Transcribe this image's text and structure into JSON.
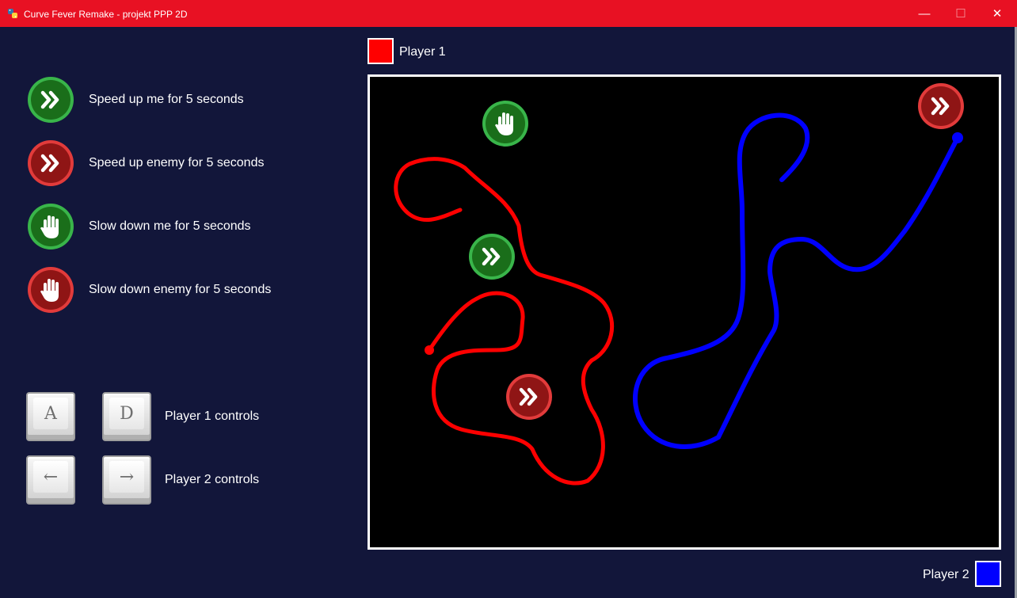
{
  "window": {
    "title": "Curve Fever Remake - projekt PPP 2D",
    "minimize_symbol": "—",
    "maximize_symbol": "☐",
    "close_symbol": "✕"
  },
  "legend": [
    {
      "label": "Speed up me for 5 seconds",
      "icon": "double-chevron-icon",
      "color": "green"
    },
    {
      "label": "Speed up enemy for 5 seconds",
      "icon": "double-chevron-icon",
      "color": "red"
    },
    {
      "label": "Slow down me for 5 seconds",
      "icon": "hand-icon",
      "color": "green"
    },
    {
      "label": "Slow down enemy for 5 seconds",
      "icon": "hand-icon",
      "color": "red"
    }
  ],
  "controls": {
    "player1": {
      "left_key": "A",
      "right_key": "D",
      "label": "Player 1 controls"
    },
    "player2": {
      "left_key": "←",
      "right_key": "→",
      "label": "Player 2 controls"
    }
  },
  "players": [
    {
      "name": "Player 1",
      "color": "#ff0000"
    },
    {
      "name": "Player 2",
      "color": "#0000ff"
    }
  ],
  "colors": {
    "background": "#12163a",
    "titlebar": "#e81123",
    "arena": "#000000",
    "green_badge": "#1a6e1a",
    "green_ring": "#39b54a",
    "red_badge": "#8f1515",
    "red_ring": "#e23b3b"
  }
}
